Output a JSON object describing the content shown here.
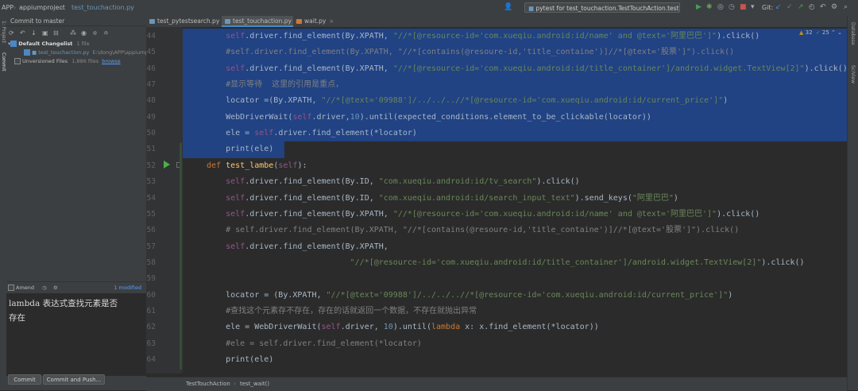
{
  "topbar": {
    "crumbs": [
      "APP",
      "appiumproject",
      "test_touchaction.py"
    ],
    "run_config": "pytest for test_touchaction.TestTouchAction.test_lambe",
    "git_label": "Git:"
  },
  "commit_panel": {
    "tab_label": "Commit to master",
    "default_changelist": "Default Changelist",
    "default_changelist_count": "1 file",
    "changed_file": "test_touchaction.py",
    "changed_file_path": "E:\\dong\\APP\\appiumproject",
    "unversioned_label": "Unversioned Files",
    "unversioned_count": "1,886 files",
    "browse_label": "browse",
    "amend_label": "Amend",
    "modified_label": "1 modified",
    "message_line1": "lambda 表达式查找元素是否",
    "message_line2": "存在",
    "commit_button": "Commit",
    "commit_push_button": "Commit and Push..."
  },
  "editor_tabs": [
    {
      "label": "test_pytestsearch.py",
      "active": false
    },
    {
      "label": "test_touchaction.py",
      "active": true
    },
    {
      "label": "wait.py",
      "active": false
    }
  ],
  "inspections": {
    "warnings": "32",
    "weak": "25"
  },
  "code": {
    "lines": [
      {
        "n": "44",
        "s": 1,
        "parts": [
          [
            "    ",
            "pl"
          ],
          [
            "self",
            "slf"
          ],
          [
            ".driver.find_element(By.XPATH, ",
            "pl"
          ],
          [
            "\"//*[@resource-id='com.xueqiu.android:id/name' and @text='阿里巴巴']\"",
            "str"
          ],
          [
            ").click()",
            "pl"
          ]
        ]
      },
      {
        "n": "45",
        "s": 1,
        "parts": [
          [
            "    ",
            "pl"
          ],
          [
            "#self.driver.find_element(By.XPATH, \"//*[contains(@resoure-id,'title_containe')]//*[@text='股票']\").click()",
            "cmt"
          ]
        ]
      },
      {
        "n": "46",
        "s": 1,
        "parts": [
          [
            "    ",
            "pl"
          ],
          [
            "self",
            "slf"
          ],
          [
            ".driver.find_element(By.XPATH, ",
            "pl"
          ],
          [
            "\"//*[@resource-id='com.xueqiu.android:id/title_container']/android.widget.TextView[2]\"",
            "str"
          ],
          [
            ").click()",
            "pl"
          ]
        ]
      },
      {
        "n": "47",
        "s": 1,
        "parts": [
          [
            "    ",
            "pl"
          ],
          [
            "#显示等待  这里的引用是重点，",
            "cmt"
          ]
        ]
      },
      {
        "n": "48",
        "s": 1,
        "parts": [
          [
            "    locator =(By.XPATH, ",
            "pl"
          ],
          [
            "\"//*[@text='09988']/../../..//*[@resource-id='com.xueqiu.android:id/current_price']\"",
            "str"
          ],
          [
            ")",
            "pl"
          ]
        ]
      },
      {
        "n": "49",
        "s": 1,
        "parts": [
          [
            "    WebDriverWait(",
            "pl"
          ],
          [
            "self",
            "slf"
          ],
          [
            ".driver,",
            "pl"
          ],
          [
            "10",
            "num"
          ],
          [
            ").until(expected_conditions.element_to_be_clickable(locator))",
            "pl"
          ]
        ]
      },
      {
        "n": "50",
        "s": 1,
        "parts": [
          [
            "    ele = ",
            "pl"
          ],
          [
            "self",
            "slf"
          ],
          [
            ".driver.find_element(*locator)",
            "pl"
          ]
        ]
      },
      {
        "n": "51",
        "s": 1,
        "parts": [
          [
            "    print(ele)",
            "pl"
          ]
        ]
      },
      {
        "n": "52",
        "s": 0,
        "parts": [
          [
            "def ",
            "kw"
          ],
          [
            "test_lambe",
            "fn"
          ],
          [
            "(",
            "pl"
          ],
          [
            "self",
            "slf"
          ],
          [
            "):",
            "pl"
          ]
        ]
      },
      {
        "n": "53",
        "s": 0,
        "parts": [
          [
            "    ",
            "pl"
          ],
          [
            "self",
            "slf"
          ],
          [
            ".driver.find_element(By.ID, ",
            "pl"
          ],
          [
            "\"com.xueqiu.android:id/tv_search\"",
            "str"
          ],
          [
            ").click()",
            "pl"
          ]
        ]
      },
      {
        "n": "54",
        "s": 0,
        "parts": [
          [
            "    ",
            "pl"
          ],
          [
            "self",
            "slf"
          ],
          [
            ".driver.find_element(By.ID, ",
            "pl"
          ],
          [
            "\"com.xueqiu.android:id/search_input_text\"",
            "str"
          ],
          [
            ").send_keys(",
            "pl"
          ],
          [
            "\"阿里巴巴\"",
            "str"
          ],
          [
            ")",
            "pl"
          ]
        ]
      },
      {
        "n": "55",
        "s": 0,
        "parts": [
          [
            "    ",
            "pl"
          ],
          [
            "self",
            "slf"
          ],
          [
            ".driver.find_element(By.XPATH, ",
            "pl"
          ],
          [
            "\"//*[@resource-id='com.xueqiu.android:id/name' and @text='阿里巴巴']\"",
            "str"
          ],
          [
            ").click()",
            "pl"
          ]
        ]
      },
      {
        "n": "56",
        "s": 0,
        "parts": [
          [
            "    ",
            "pl"
          ],
          [
            "# self.driver.find_element(By.XPATH, \"//*[contains(@resoure-id,'title_containe')]//*[@text='股票']\").click()",
            "cmt"
          ]
        ]
      },
      {
        "n": "57",
        "s": 0,
        "parts": [
          [
            "    ",
            "pl"
          ],
          [
            "self",
            "slf"
          ],
          [
            ".driver.find_element(By.XPATH,",
            "pl"
          ]
        ]
      },
      {
        "n": "58",
        "s": 0,
        "parts": [
          [
            "                              ",
            "pl"
          ],
          [
            "\"//*[@resource-id='com.xueqiu.android:id/title_container']/android.widget.TextView[2]\"",
            "str"
          ],
          [
            ").click()",
            "pl"
          ]
        ]
      },
      {
        "n": "59",
        "s": 0,
        "parts": [
          [
            "",
            "pl"
          ]
        ]
      },
      {
        "n": "60",
        "s": 0,
        "parts": [
          [
            "    locator = (By.XPATH, ",
            "pl"
          ],
          [
            "\"//*[@text='09988']/../../..//*[@resource-id='com.xueqiu.android:id/current_price']\"",
            "str"
          ],
          [
            ")",
            "pl"
          ]
        ]
      },
      {
        "n": "61",
        "s": 0,
        "parts": [
          [
            "    ",
            "pl"
          ],
          [
            "#查找这个元素存不存在，存在的话就返回一个数据，不存在就抛出异常",
            "cmt"
          ]
        ]
      },
      {
        "n": "62",
        "s": 0,
        "parts": [
          [
            "    ele = WebDriverWait(",
            "pl"
          ],
          [
            "self",
            "slf"
          ],
          [
            ".driver, ",
            "pl"
          ],
          [
            "10",
            "num"
          ],
          [
            ").until(",
            "pl"
          ],
          [
            "lambda ",
            "kw"
          ],
          [
            "x: x.find_element(*locator))",
            "pl"
          ]
        ]
      },
      {
        "n": "63",
        "s": 0,
        "parts": [
          [
            "    ",
            "pl"
          ],
          [
            "#ele = self.driver.find_element(*locator)",
            "cmt"
          ]
        ]
      },
      {
        "n": "64",
        "s": 0,
        "parts": [
          [
            "    print(ele)",
            "pl"
          ]
        ]
      }
    ]
  },
  "statusbar": {
    "crumb1": "TestTouchAction",
    "crumb2": "test_wait()"
  },
  "sidebars": {
    "left_top": "1: Project",
    "left_commit": "Commit",
    "right_top": "Database",
    "right_scmode": "SciView"
  }
}
